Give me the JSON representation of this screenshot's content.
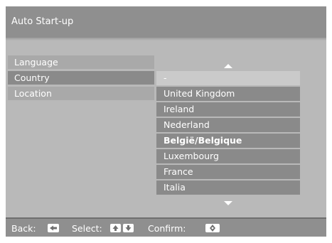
{
  "header": {
    "title": "Auto Start-up"
  },
  "menu": {
    "items": [
      {
        "label": "Language",
        "selected": false
      },
      {
        "label": "Country",
        "selected": true
      },
      {
        "label": "Location",
        "selected": false
      }
    ]
  },
  "country_list": {
    "items": [
      {
        "label": "-"
      },
      {
        "label": "United Kingdom"
      },
      {
        "label": "Ireland"
      },
      {
        "label": "Nederland"
      },
      {
        "label": "België/Belgique"
      },
      {
        "label": "Luxembourg"
      },
      {
        "label": "France"
      },
      {
        "label": "Italia"
      }
    ]
  },
  "footer": {
    "back_label": "Back:",
    "select_label": "Select:",
    "confirm_label": "Confirm:"
  }
}
